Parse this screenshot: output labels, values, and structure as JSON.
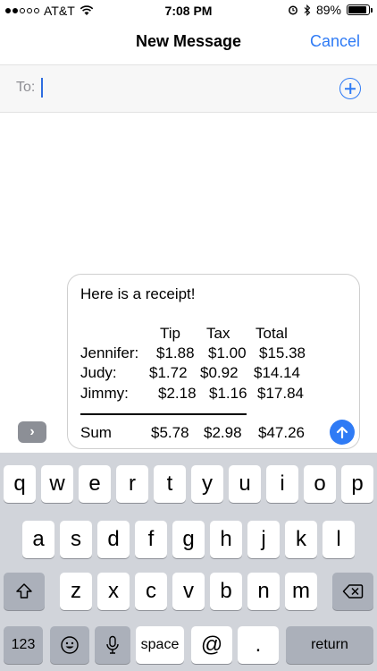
{
  "status": {
    "carrier": "AT&T",
    "time": "7:08 PM",
    "battery": "89%"
  },
  "nav": {
    "title": "New Message",
    "cancel": "Cancel"
  },
  "compose": {
    "to_label": "To:"
  },
  "message": {
    "greeting": "Here is a receipt!",
    "headers": [
      "Tip",
      "Tax",
      "Total"
    ],
    "rows": [
      {
        "name": "Jennifer:",
        "tip": "$1.88",
        "tax": "$1.00",
        "total": "$15.38"
      },
      {
        "name": "Judy:",
        "tip": "$1.72",
        "tax": "$0.92",
        "total": "$14.14"
      },
      {
        "name": "Jimmy:",
        "tip": "$2.18",
        "tax": "$1.16",
        "total": "$17.84"
      }
    ],
    "sum": {
      "name": "Sum",
      "tip": "$5.78",
      "tax": "$2.98",
      "total": "$47.26"
    }
  },
  "keyboard": {
    "row1": [
      "q",
      "w",
      "e",
      "r",
      "t",
      "y",
      "u",
      "i",
      "o",
      "p"
    ],
    "row2": [
      "a",
      "s",
      "d",
      "f",
      "g",
      "h",
      "j",
      "k",
      "l"
    ],
    "row3": [
      "z",
      "x",
      "c",
      "v",
      "b",
      "n",
      "m"
    ],
    "numbers_key": "123",
    "space_key": "space",
    "at_key": "@",
    "period_key": ".",
    "return_key": "return"
  }
}
